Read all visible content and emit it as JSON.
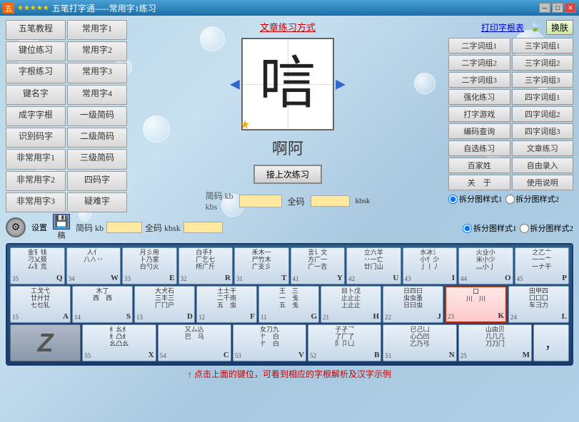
{
  "titleBar": {
    "stars": "★★★★★",
    "title": "五笔打字通-----常用字1练习",
    "minimize": "─",
    "maximize": "□",
    "close": "✕"
  },
  "topLink": "文章练习方式",
  "rightTop": {
    "printLabel": "打印字根表",
    "exchangeLabel": "换肤"
  },
  "leftNav": [
    [
      "五笔教程",
      "常用字1"
    ],
    [
      "键位练习",
      "常用字2"
    ],
    [
      "字根练习",
      "常用字3"
    ],
    [
      "键名字",
      "常用字4"
    ],
    [
      "成字字根",
      "一级简码"
    ],
    [
      "识别码字",
      "二级简码"
    ],
    [
      "非常用字1",
      "三级简码"
    ],
    [
      "非常用字2",
      "四码字"
    ],
    [
      "非常用字3",
      "疑难字"
    ]
  ],
  "rightNav": [
    [
      "二字词组1",
      "三字词组1"
    ],
    [
      "二字词组2",
      "三字词组2"
    ],
    [
      "二字词组3",
      "三字词组3"
    ],
    [
      "强化练习",
      "四字词组1"
    ],
    [
      "打字游戏",
      "四字词组2"
    ],
    [
      "编码查询",
      "四字词组3"
    ],
    [
      "自选练习",
      "文章练习"
    ],
    [
      "百家姓",
      "自由录入"
    ],
    [
      "关　于",
      "使用说明"
    ]
  ],
  "charDisplay": "唁",
  "charPinyin": "啊阿",
  "practiceBtn": "接上次练习",
  "shortcodeLabel": "简码",
  "shortcodeValue": "kb",
  "shortcodeValue2": "kbs",
  "fullcodeLabel": "全码",
  "fullcodeValue": "kbsk",
  "splitLabel1": "拆分图样式1",
  "splitLabel2": "拆分图样式2",
  "saveLabel": "稿",
  "settingsLabel": "设置",
  "bottomTip": "↑点击上面的键位，可看到相应的字根解析及汉字示例",
  "keys": [
    {
      "row": 0,
      "cells": [
        {
          "radicals": "金钅钱\n刁乂叕\n厶钅㐬",
          "number": "35",
          "letter": "Q"
        },
        {
          "radicals": "人亻\n八∧ 丷",
          "number": "34",
          "letter": "W"
        },
        {
          "radicals": "月彡用\n⺊乃家\n白勺火",
          "number": "33",
          "letter": "E"
        },
        {
          "radicals": "白手扌\n厂乞七\n所广斤",
          "number": "32",
          "letter": "R"
        },
        {
          "radicals": "禾木一\n尸竹木\n广支彡",
          "number": "31",
          "letter": "T"
        },
        {
          "radicals": "言讠文\n方广一\n广一吉",
          "number": "41",
          "letter": "Y"
        },
        {
          "radicals": "立六羊\n丷一亡\n廿门山",
          "number": "42",
          "letter": "U"
        },
        {
          "radicals": "水冰氵\n小忄少\n亅丨丿",
          "number": "43",
          "letter": "I"
        },
        {
          "radicals": "火业小\n米小少\n灬小亅",
          "number": "44",
          "letter": "O"
        },
        {
          "radicals": "之乙亠\n一一亠\n一ナ干",
          "number": "45",
          "letter": "P"
        }
      ]
    },
    {
      "row": 1,
      "cells": [
        {
          "radicals": "工戈弋\n廿廾廿\n七乜钆",
          "number": "15",
          "letter": "A"
        },
        {
          "radicals": "木丁\n西　西",
          "number": "14",
          "letter": "S"
        },
        {
          "radicals": "大犬石\n三丰三\n厂冂户",
          "number": "13",
          "letter": "D"
        },
        {
          "radicals": "土士干\n二千雨\n五　虫",
          "number": "12",
          "letter": "F"
        },
        {
          "radicals": "王　三\n一　戋\n五　戋",
          "number": "11",
          "letter": "G"
        },
        {
          "radicals": "目卜戊\n止止止\n上止止",
          "number": "21",
          "letter": "H"
        },
        {
          "radicals": "日四曰\n虫虫蚤\n日曰虫",
          "number": "22",
          "letter": "J"
        },
        {
          "radicals": "口　\n川　川",
          "number": "23",
          "letter": "K",
          "highlighted": true
        },
        {
          "radicals": "田甲四\n囗囗囗\n车彐力",
          "number": "24",
          "letter": "L"
        }
      ]
    },
    {
      "row": 2,
      "cells": [
        {
          "radicals": "Z",
          "isZ": true
        },
        {
          "radicals": "纟幺纟\n纟凸纟\n幺凸幺",
          "number": "55",
          "letter": "X"
        },
        {
          "radicals": "又ム亾\n巴　马",
          "number": "54",
          "letter": "C"
        },
        {
          "radicals": "女刀九\n㣺　白\n㣺　白",
          "number": "53",
          "letter": "V"
        },
        {
          "radicals": "子孑乛\n了厂了\n阝卩凵",
          "number": "52",
          "letter": "B"
        },
        {
          "radicals": "已己凵\n心凸凹\n乙乃弓",
          "number": "51",
          "letter": "N"
        },
        {
          "radicals": "山由贝\n几几几\n刀刀门",
          "number": "25",
          "letter": "M"
        },
        {
          "radicals": "，",
          "isComma": true
        }
      ]
    }
  ]
}
